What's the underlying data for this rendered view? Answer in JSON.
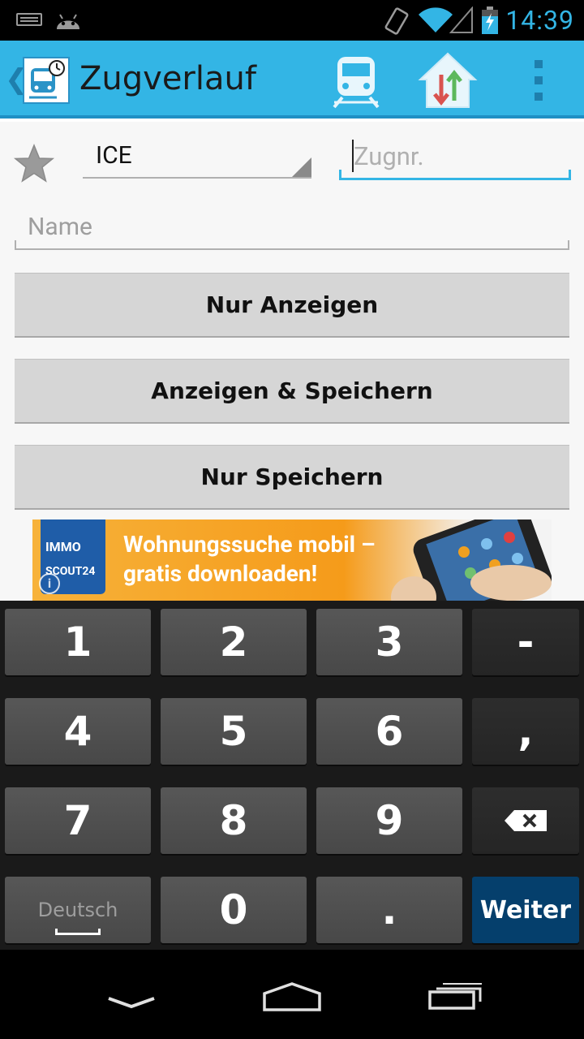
{
  "status_bar": {
    "time": "14:39"
  },
  "action_bar": {
    "title": "Zugverlauf",
    "actions": [
      "train-icon",
      "home-connection-icon",
      "overflow-menu-icon"
    ]
  },
  "form": {
    "train_type": "ICE",
    "train_number_placeholder": "Zugnr.",
    "name_placeholder": "Name",
    "buttons": {
      "show_only": "Nur Anzeigen",
      "show_and_save": "Anzeigen & Speichern",
      "save_only": "Nur Speichern"
    }
  },
  "ad": {
    "logo_line1": "IMMO",
    "logo_line2": "SCOUT24",
    "line1": "Wohnungssuche mobil –",
    "line2": "gratis downloaden!",
    "info": "i"
  },
  "keyboard": {
    "keys": [
      "1",
      "2",
      "3",
      "-",
      "4",
      "5",
      "6",
      ",",
      "7",
      "8",
      "9",
      "⌫",
      "Deutsch",
      "0",
      ".",
      "Weiter"
    ]
  },
  "colors": {
    "accent": "#33b5e5",
    "action_key": "#053f6c"
  }
}
